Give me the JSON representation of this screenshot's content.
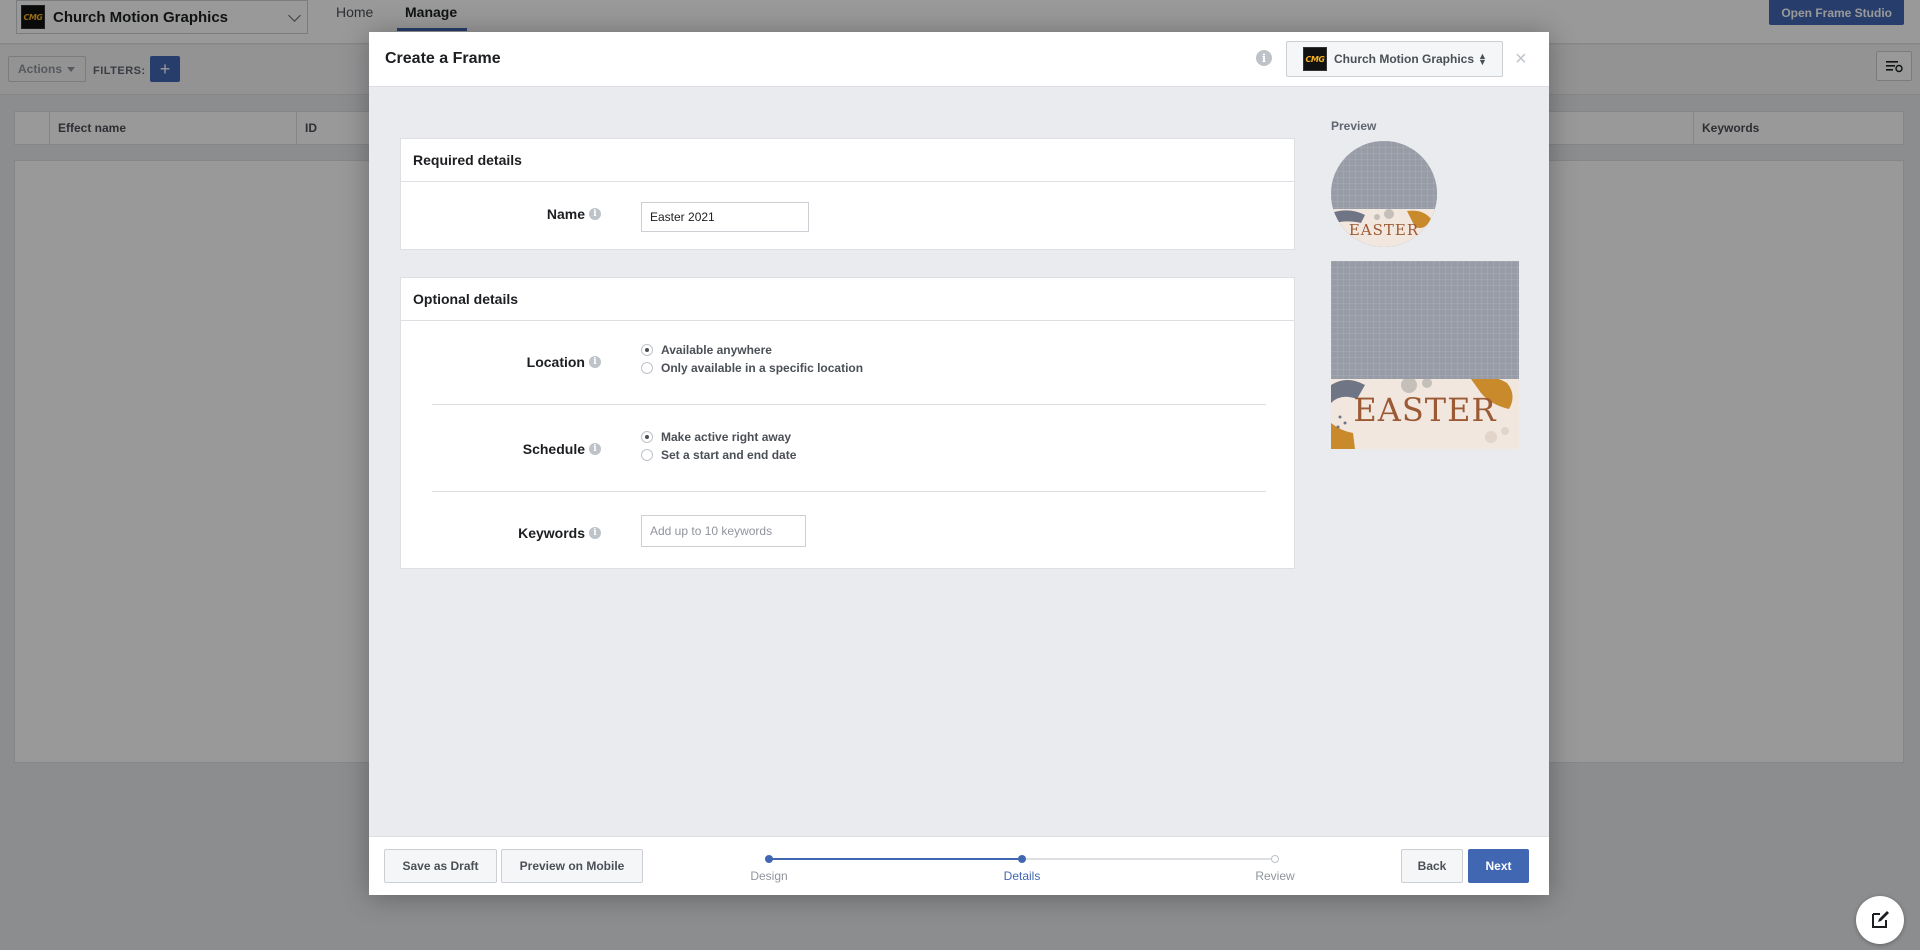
{
  "background": {
    "page_name": "Church Motion Graphics",
    "logo_text": "CMG",
    "nav_tabs": [
      "Home",
      "Manage"
    ],
    "open_frame_studio": "Open Frame Studio",
    "actions_label": "Actions",
    "filters_label": "FILTERS:",
    "add_filter": "+",
    "table_columns": [
      "Effect name",
      "ID",
      "Keywords"
    ]
  },
  "modal": {
    "title": "Create a Frame",
    "info_glyph": "i",
    "page_name": "Church Motion Graphics",
    "close_glyph": "×",
    "required": {
      "title": "Required details",
      "name_label": "Name",
      "name_value": "Easter 2021"
    },
    "optional": {
      "title": "Optional details",
      "location_label": "Location",
      "location_options": [
        "Available anywhere",
        "Only available in a specific location"
      ],
      "location_selected": 0,
      "schedule_label": "Schedule",
      "schedule_options": [
        "Make active right away",
        "Set a start and end date"
      ],
      "schedule_selected": 0,
      "keywords_label": "Keywords",
      "keywords_placeholder": "Add up to 10 keywords"
    },
    "preview": {
      "label": "Preview",
      "frame_text": "EASTER"
    },
    "footer": {
      "save_draft": "Save as Draft",
      "preview_mobile": "Preview on Mobile",
      "steps": [
        "Design",
        "Details",
        "Review"
      ],
      "current_step": 1,
      "back": "Back",
      "next": "Next"
    }
  },
  "colors": {
    "accent": "#4267b2",
    "frame_text": "#9b5a34",
    "frame_gold": "#c98a2c"
  }
}
